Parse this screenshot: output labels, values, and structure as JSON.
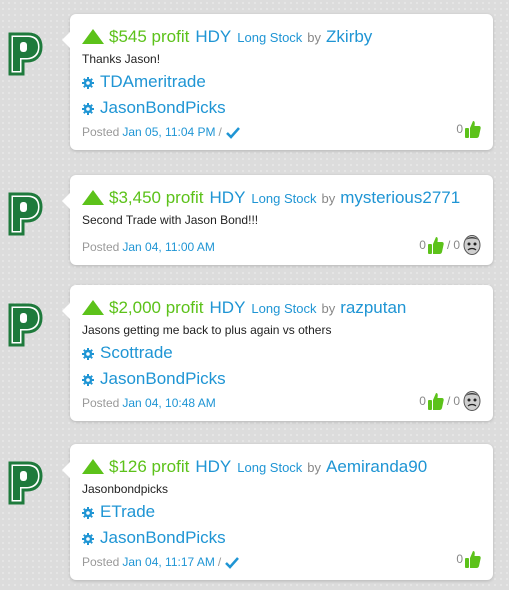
{
  "colors": {
    "profit": "#5cc21a",
    "link": "#1f95d4",
    "muted": "#999999",
    "logo": "#1e7a3c"
  },
  "posts": [
    {
      "profit": "$545 profit",
      "ticker": "HDY",
      "stock_type": "Long Stock",
      "by": "by",
      "user": "Zkirby",
      "message": "Thanks Jason!",
      "tags": [
        "TDAmeritrade",
        "JasonBondPicks"
      ],
      "posted_label": "Posted",
      "date": "Jan 05, 11:04 PM",
      "sep": "/",
      "verified": true,
      "likes": "0",
      "dislikes": null
    },
    {
      "profit": "$3,450 profit",
      "ticker": "HDY",
      "stock_type": "Long Stock",
      "by": "by",
      "user": "mysterious2771",
      "message": "Second Trade with Jason Bond!!!",
      "tags": [],
      "posted_label": "Posted",
      "date": "Jan 04, 11:00 AM",
      "sep": "",
      "verified": false,
      "likes": "0",
      "dislikes": "0"
    },
    {
      "profit": "$2,000 profit",
      "ticker": "HDY",
      "stock_type": "Long Stock",
      "by": "by",
      "user": "razputan",
      "message": "Jasons getting me back to plus again vs others",
      "tags": [
        "Scottrade",
        "JasonBondPicks"
      ],
      "posted_label": "Posted",
      "date": "Jan 04, 10:48 AM",
      "sep": "",
      "verified": false,
      "likes": "0",
      "dislikes": "0"
    },
    {
      "profit": "$126 profit",
      "ticker": "HDY",
      "stock_type": "Long Stock",
      "by": "by",
      "user": "Aemiranda90",
      "message": "Jasonbondpicks",
      "tags": [
        "ETrade",
        "JasonBondPicks"
      ],
      "posted_label": "Posted",
      "date": "Jan 04, 11:17 AM",
      "sep": "/",
      "verified": true,
      "likes": "0",
      "dislikes": null
    }
  ],
  "vote_sep": "/",
  "icons": {
    "trend": "up-triangle-icon",
    "tag": "gear-icon",
    "check": "checkmark-icon",
    "like": "thumbs-up-icon",
    "dislike": "frowning-face-icon",
    "logo": "p-logo-icon"
  }
}
